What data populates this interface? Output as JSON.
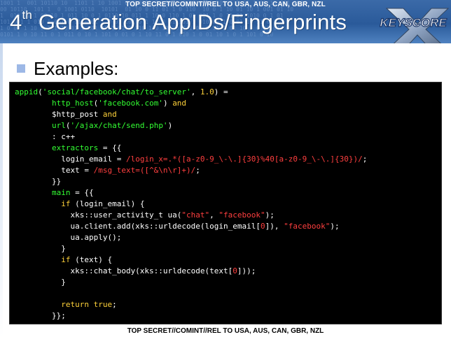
{
  "classification": {
    "top": "TOP SECRET//COMINT//REL TO USA, AUS, CAN, GBR, NZL",
    "bottom": "TOP SECRET//COMINT//REL TO USA, AUS, CAN, GBR, NZL"
  },
  "header": {
    "title_num": "4",
    "title_sup": "th",
    "title_rest": " Generation AppIDs/Fingerprints",
    "logo_text": "KEYSCORE"
  },
  "bullet": {
    "text": "Examples:"
  },
  "code": {
    "l1_fn": "appid",
    "l1_p1": "(",
    "l1_s1": "'social/facebook/chat/to_server'",
    "l1_p2": ", ",
    "l1_n1": "1.0",
    "l1_p3": ") =",
    "l2_ind": "        ",
    "l2_fn": "http_host",
    "l2_p1": "(",
    "l2_s1": "'facebook.com'",
    "l2_p2": ") ",
    "l2_kw": "and",
    "l3_ind": "        ",
    "l3_txt": "$http_post ",
    "l3_kw": "and",
    "l4_ind": "        ",
    "l4_fn": "url",
    "l4_p1": "(",
    "l4_s1": "'/ajax/chat/send.php'",
    "l4_p2": ")",
    "l5_txt": "        : c++",
    "l6_ind": "        ",
    "l6_kw": "extractors",
    "l6_txt": " = {{",
    "l7_txt": "          login_email = ",
    "l7_rx": "/login_x=.*([a-z0-9_\\-\\.]{30}%40[a-z0-9_\\-\\.]{30})/",
    "l7_end": ";",
    "l8_txt": "          text = ",
    "l8_rx": "/msg_text=([^&\\n\\r]+)/",
    "l8_end": ";",
    "l9_txt": "        }}",
    "l10_ind": "        ",
    "l10_kw": "main",
    "l10_txt": " = {{",
    "l11_ind": "          ",
    "l11_kw": "if",
    "l11_txt": " (login_email) {",
    "l12_txt": "            xks::user_activity_t ua(",
    "l12_s1": "\"chat\"",
    "l12_p1": ", ",
    "l12_s2": "\"facebook\"",
    "l12_p2": ");",
    "l13_txt": "            ua.client.add(xks::urldecode(login_email[",
    "l13_n1": "0",
    "l13_p1": "]), ",
    "l13_s1": "\"facebook\"",
    "l13_p2": ");",
    "l14_txt": "            ua.apply();",
    "l15_txt": "          }",
    "l16_ind": "          ",
    "l16_kw": "if",
    "l16_txt": " (text) {",
    "l17_txt": "            xks::chat_body(xks::urldecode(text[",
    "l17_n1": "0",
    "l17_p1": "]));",
    "l18_txt": "          }",
    "l19_txt": "",
    "l20_ind": "          ",
    "l20_kw": "return",
    "l20_sp": " ",
    "l20_n1": "true",
    "l20_p1": ";",
    "l21_txt": "        }};"
  },
  "colors": {
    "header_blue": "#2a5a9a",
    "keyword_yellow": "#ffd23a",
    "string_green": "#33ff33",
    "literal_red": "#ff3f3f",
    "code_bg": "#000000",
    "bullet_square": "#9db8e6"
  }
}
